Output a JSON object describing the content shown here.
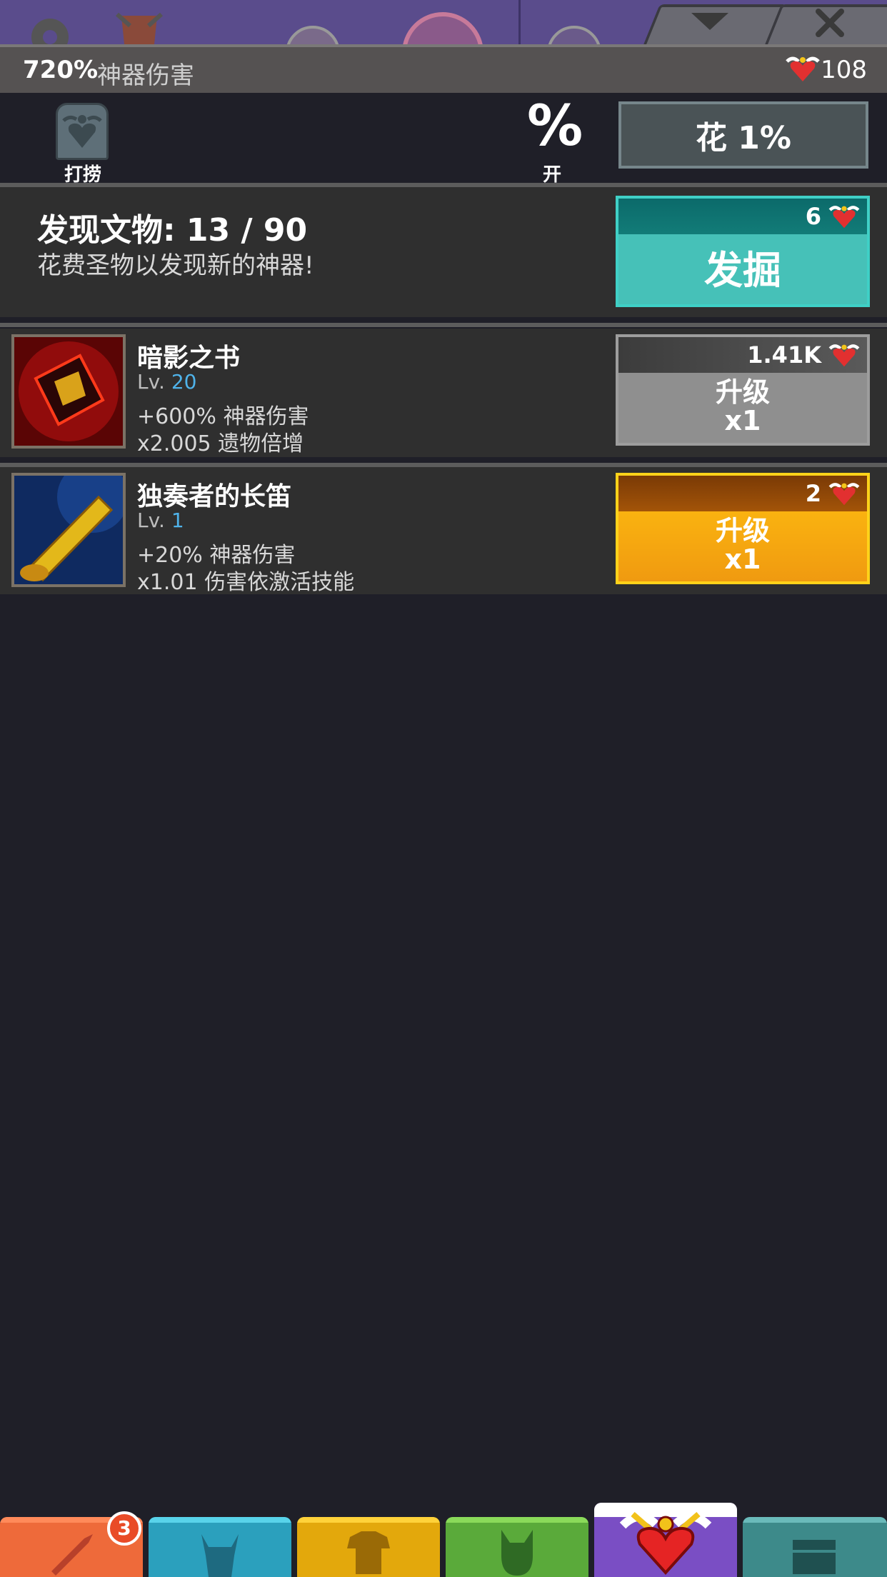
{
  "header": {
    "damage_value": "720%",
    "damage_label": "神器伤害",
    "relic_count": "108"
  },
  "salvage": {
    "label": "打捞",
    "percent_symbol": "%",
    "percent_label": "开",
    "spend_label": "花 1%"
  },
  "discover": {
    "title": "发现文物: 13 / 90",
    "subtitle": "花费圣物以发现新的神器!",
    "cost": "6",
    "button_label": "发掘"
  },
  "artifacts": [
    {
      "name": "暗影之书",
      "level_prefix": "Lv.",
      "level": "20",
      "stat1": "+600% 神器伤害",
      "stat2": "x2.005 遗物倍增",
      "cost": "1.41K",
      "button_label": "升级",
      "button_multiplier": "x1",
      "icon": "dark-spellbook-icon"
    },
    {
      "name": "独奏者的长笛",
      "level_prefix": "Lv.",
      "level": "1",
      "stat1": "+20% 神器伤害",
      "stat2": "x1.01 伤害依激活技能",
      "cost": "2",
      "button_label": "升级",
      "button_multiplier": "x1",
      "icon": "golden-flute-icon"
    }
  ],
  "nav": {
    "badge_count": "3",
    "tabs": [
      "sword-icon",
      "viking-helmet-icon",
      "shirt-icon",
      "pet-icon",
      "artifact-heart-icon",
      "chest-icon"
    ]
  },
  "colors": {
    "background": "#1f1f28",
    "teal": "#46c1b8",
    "gold": "#ffbf10",
    "level_blue": "#4fb3ea",
    "badge_red": "#e94b27"
  }
}
